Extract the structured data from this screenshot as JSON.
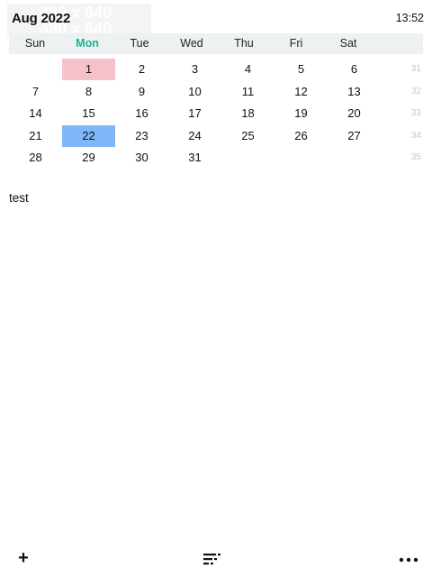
{
  "header": {
    "month_label": "Aug 2022",
    "clock": "13:52",
    "watermark_line1": "480 x 640",
    "watermark_line2": "480 x 640"
  },
  "weekdays": [
    "Sun",
    "Mon",
    "Tue",
    "Wed",
    "Thu",
    "Fri",
    "Sat"
  ],
  "today_weekday_index": 1,
  "weeks": [
    {
      "days": [
        "",
        "1",
        "2",
        "3",
        "4",
        "5",
        "6"
      ],
      "week_number": "31"
    },
    {
      "days": [
        "7",
        "8",
        "9",
        "10",
        "11",
        "12",
        "13"
      ],
      "week_number": "32"
    },
    {
      "days": [
        "14",
        "15",
        "16",
        "17",
        "18",
        "19",
        "20"
      ],
      "week_number": "33"
    },
    {
      "days": [
        "21",
        "22",
        "23",
        "24",
        "25",
        "26",
        "27"
      ],
      "week_number": "34"
    },
    {
      "days": [
        "28",
        "29",
        "30",
        "31",
        "",
        "",
        ""
      ],
      "week_number": "35"
    }
  ],
  "highlighted_day": "1",
  "selected_day": "22",
  "colors": {
    "today_label": "#19b391",
    "holiday": "#f6c1cb",
    "selected": "#7fb7f9",
    "weekday_bar": "#eef1f1",
    "week_number": "#c7c7c7"
  },
  "note": "test",
  "toolbar": {
    "add_label": "+",
    "list_icon": "sort-list-icon",
    "more_icon": "more-dots-icon"
  }
}
